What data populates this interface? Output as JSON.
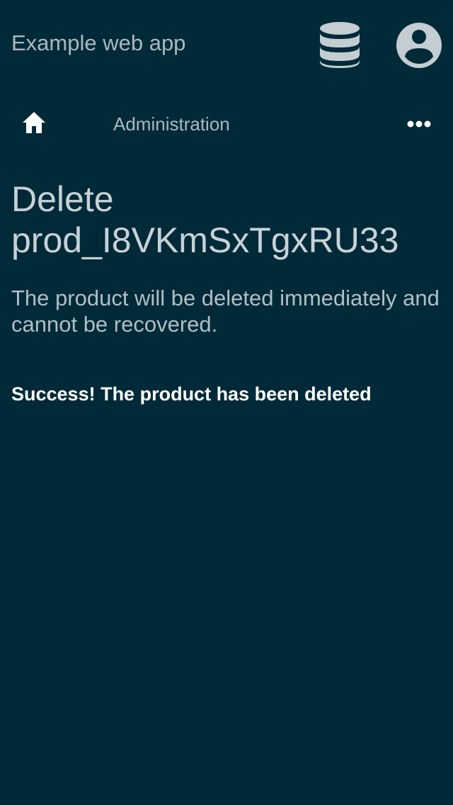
{
  "header": {
    "app_title": "Example web app",
    "database_icon": "database-icon",
    "account_icon": "account-circle-icon"
  },
  "nav": {
    "home_icon": "home-icon",
    "section_label": "Administration",
    "more_icon": "more-horizontal-icon"
  },
  "main": {
    "title_line1": "Delete",
    "title_line2": "prod_I8VKmSxTgxRU33",
    "description": "The product will be deleted immediately and cannot be recovered.",
    "success_message": "Success! The product has been deleted"
  },
  "colors": {
    "background": "#012a38",
    "text_muted": "#a9b8bf",
    "title": "#c7d1d6",
    "success": "#ffffff",
    "icon": "#c3cdd2"
  }
}
